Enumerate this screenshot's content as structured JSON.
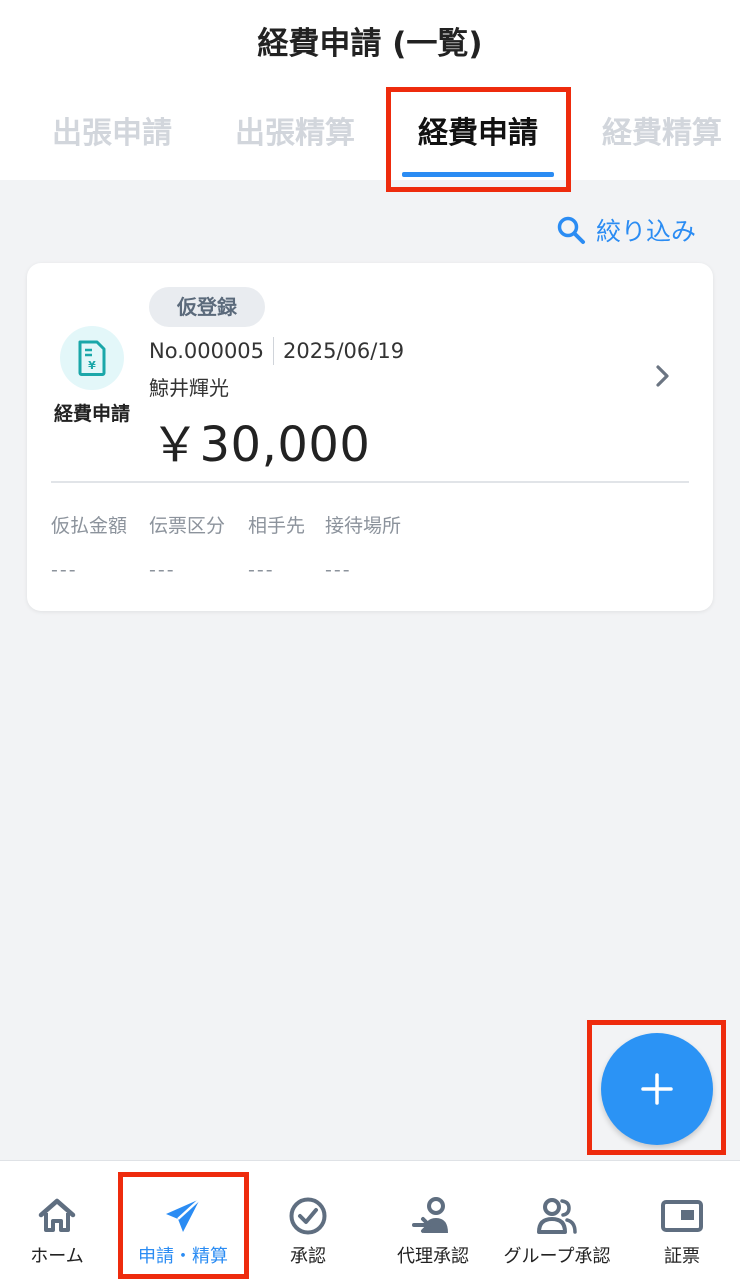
{
  "header": {
    "title": "経費申請 (一覧)"
  },
  "tabs": [
    {
      "label": "出張申請"
    },
    {
      "label": "出張精算"
    },
    {
      "label": "経費申請",
      "active": true
    },
    {
      "label": "経費精算"
    }
  ],
  "filter": {
    "label": "絞り込み",
    "icon": "search-icon"
  },
  "card": {
    "icon": "yen-document-icon",
    "type_label": "経費申請",
    "status": "仮登録",
    "number": "No.000005",
    "date": "2025/06/19",
    "applicant": "鯨井輝光",
    "amount": "￥30,000",
    "details": [
      {
        "label": "仮払金額",
        "value": "---"
      },
      {
        "label": "伝票区分",
        "value": "---"
      },
      {
        "label": "相手先",
        "value": "---"
      },
      {
        "label": "接待場所",
        "value": "---"
      }
    ]
  },
  "fab": {
    "icon": "plus-icon"
  },
  "bottom_nav": [
    {
      "label": "ホーム",
      "icon": "home-icon"
    },
    {
      "label": "申請・精算",
      "icon": "paper-plane-icon",
      "active": true
    },
    {
      "label": "承認",
      "icon": "check-circle-icon"
    },
    {
      "label": "代理承認",
      "icon": "proxy-user-icon"
    },
    {
      "label": "グループ承認",
      "icon": "group-icon"
    },
    {
      "label": "証票",
      "icon": "receipt-card-icon"
    }
  ],
  "colors": {
    "accent": "#2b8cf3",
    "highlight": "#ee2b0d",
    "background": "#f2f3f5"
  }
}
